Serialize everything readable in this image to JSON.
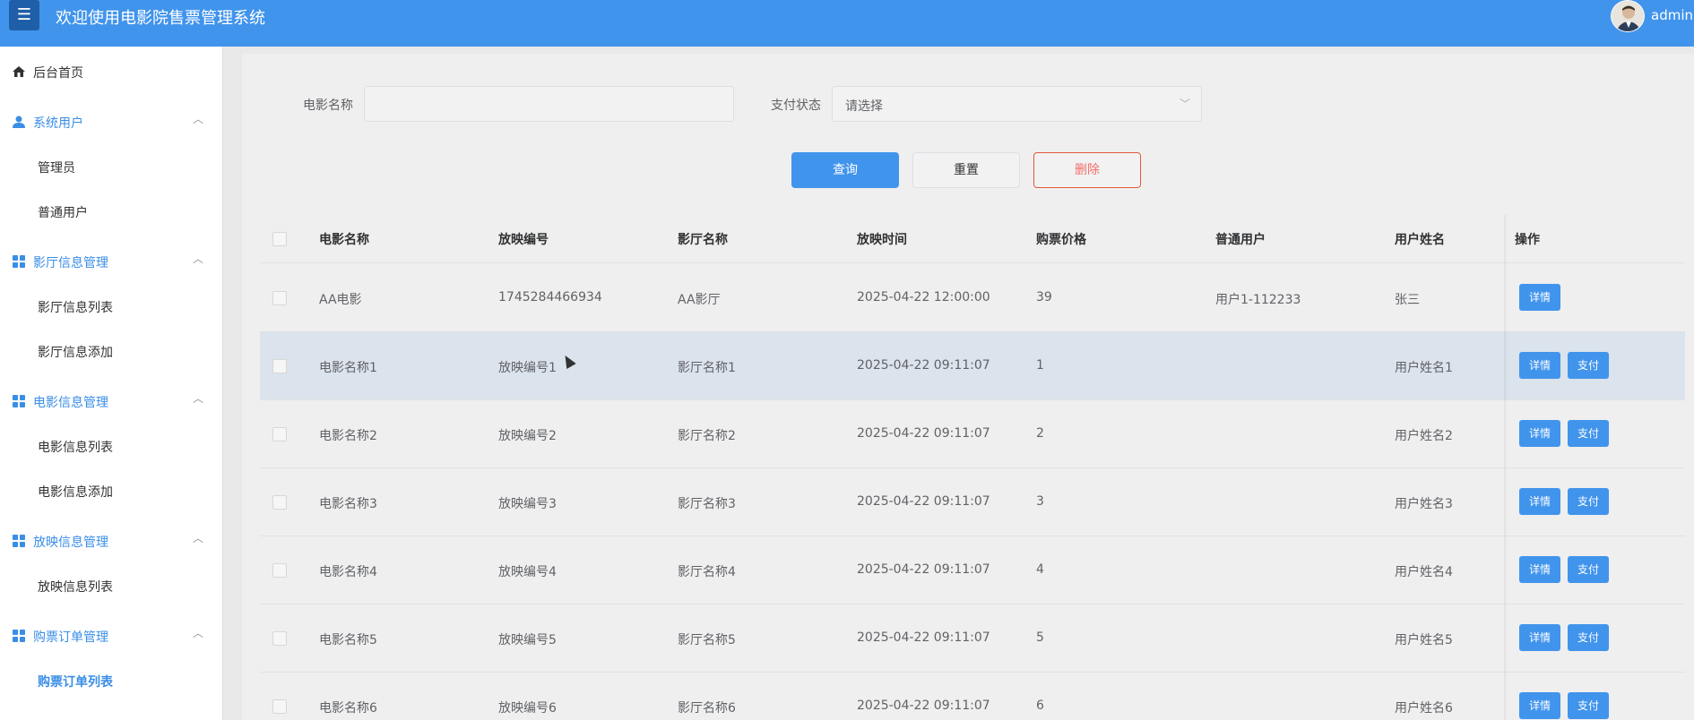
{
  "header": {
    "menu_icon": "☰",
    "title": "欢迎使用电影院售票管理系统",
    "user": "admin"
  },
  "sidebar": {
    "home": "后台首页",
    "groups": [
      {
        "label": "系统用户",
        "items": [
          "管理员",
          "普通用户"
        ]
      },
      {
        "label": "影厅信息管理",
        "items": [
          "影厅信息列表",
          "影厅信息添加"
        ]
      },
      {
        "label": "电影信息管理",
        "items": [
          "电影信息列表",
          "电影信息添加"
        ]
      },
      {
        "label": "放映信息管理",
        "items": [
          "放映信息列表"
        ]
      },
      {
        "label": "购票订单管理",
        "items": [
          "购票订单列表"
        ]
      }
    ],
    "active_item": "购票订单列表"
  },
  "search": {
    "movie_name_label": "电影名称",
    "movie_name_value": "",
    "pay_status_label": "支付状态",
    "pay_status_placeholder": "请选择",
    "query_button": "查询",
    "reset_button": "重置",
    "delete_button": "删除"
  },
  "table": {
    "headers": [
      "电影名称",
      "放映编号",
      "影厅名称",
      "放映时间",
      "购票价格",
      "普通用户",
      "用户姓名",
      "操作"
    ],
    "rows": [
      {
        "movie": "AA电影",
        "screening_no": "1745284466934",
        "hall": "AA影厅",
        "time": "2025-04-22 12:00:00",
        "price": "39",
        "user": "用户1-112233",
        "name": "张三"
      },
      {
        "movie": "电影名称1",
        "screening_no": "放映编号1",
        "hall": "影厅名称1",
        "time": "2025-04-22 09:11:07",
        "price": "1",
        "user": "",
        "name": "用户姓名1"
      },
      {
        "movie": "电影名称2",
        "screening_no": "放映编号2",
        "hall": "影厅名称2",
        "time": "2025-04-22 09:11:07",
        "price": "2",
        "user": "",
        "name": "用户姓名2"
      },
      {
        "movie": "电影名称3",
        "screening_no": "放映编号3",
        "hall": "影厅名称3",
        "time": "2025-04-22 09:11:07",
        "price": "3",
        "user": "",
        "name": "用户姓名3"
      },
      {
        "movie": "电影名称4",
        "screening_no": "放映编号4",
        "hall": "影厅名称4",
        "time": "2025-04-22 09:11:07",
        "price": "4",
        "user": "",
        "name": "用户姓名4"
      },
      {
        "movie": "电影名称5",
        "screening_no": "放映编号5",
        "hall": "影厅名称5",
        "time": "2025-04-22 09:11:07",
        "price": "5",
        "user": "",
        "name": "用户姓名5"
      },
      {
        "movie": "电影名称6",
        "screening_no": "放映编号6",
        "hall": "影厅名称6",
        "time": "2025-04-22 09:11:07",
        "price": "6",
        "user": "",
        "name": "用户姓名6"
      }
    ],
    "detail_button": "详情",
    "pay_button": "支付"
  },
  "colors": {
    "header": "#4194ec",
    "accent": "#3a8ee6",
    "danger": "#f56c6c"
  }
}
